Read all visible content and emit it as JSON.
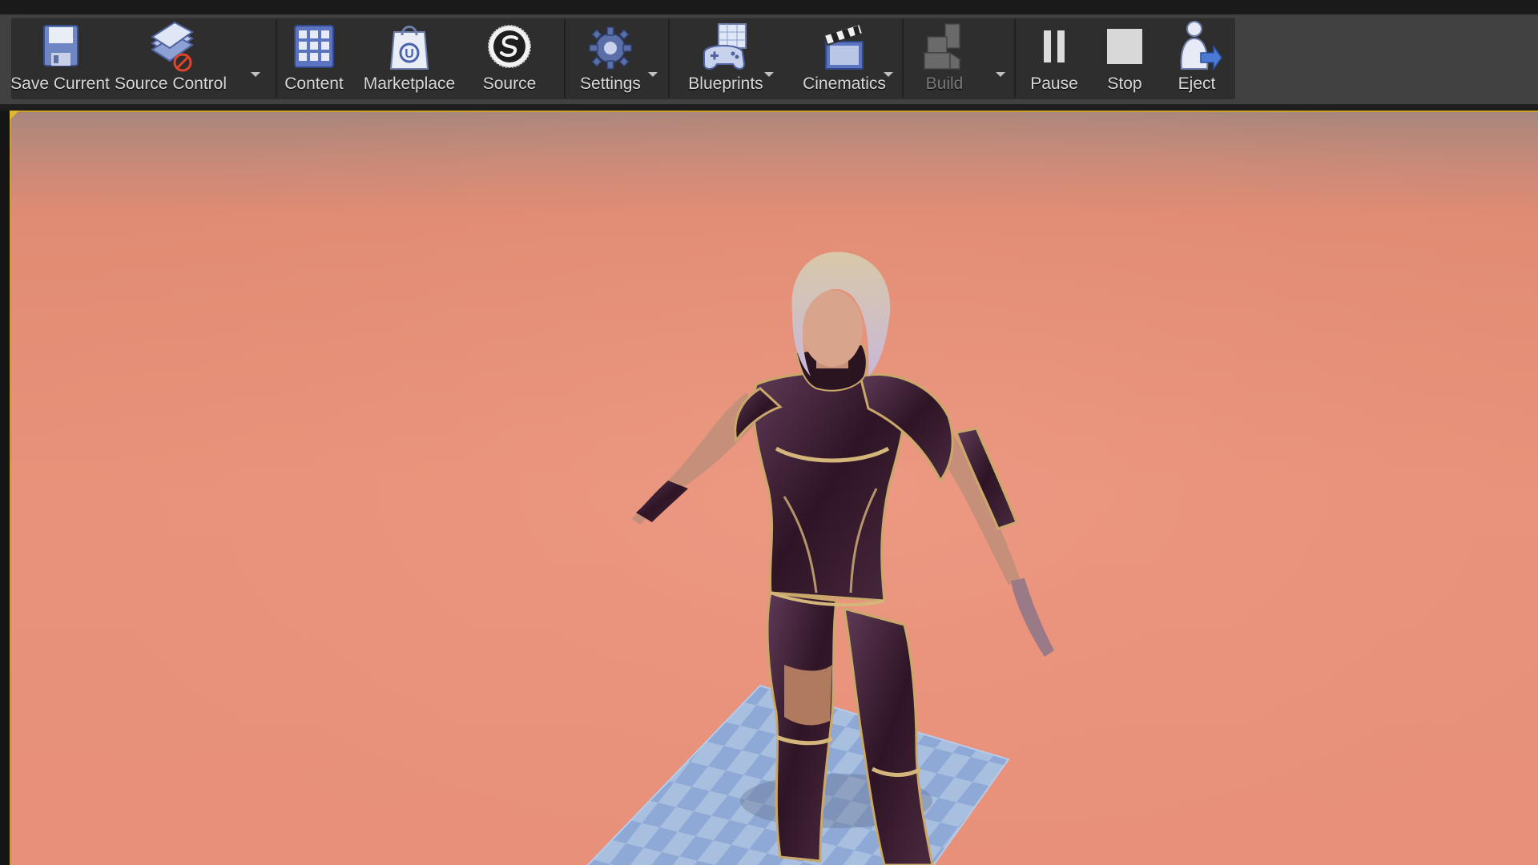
{
  "toolbar": {
    "buttons": [
      {
        "id": "save_current",
        "label": "Save Current",
        "icon": "floppy-disk-icon",
        "has_dropdown": false,
        "enabled": true
      },
      {
        "id": "source_control",
        "label": "Source Control",
        "icon": "source-control-icon",
        "has_dropdown": true,
        "enabled": true
      },
      {
        "id": "content",
        "label": "Content",
        "icon": "content-grid-icon",
        "has_dropdown": false,
        "enabled": true
      },
      {
        "id": "marketplace",
        "label": "Marketplace",
        "icon": "marketplace-bag-icon",
        "has_dropdown": false,
        "enabled": true
      },
      {
        "id": "source",
        "label": "Source",
        "icon": "source-logo-icon",
        "has_dropdown": false,
        "enabled": true
      },
      {
        "id": "settings",
        "label": "Settings",
        "icon": "gear-icon",
        "has_dropdown": true,
        "enabled": true
      },
      {
        "id": "blueprints",
        "label": "Blueprints",
        "icon": "gamepad-icon",
        "has_dropdown": true,
        "enabled": true
      },
      {
        "id": "cinematics",
        "label": "Cinematics",
        "icon": "clapperboard-icon",
        "has_dropdown": true,
        "enabled": true
      },
      {
        "id": "build",
        "label": "Build",
        "icon": "build-blocks-icon",
        "has_dropdown": true,
        "enabled": false
      },
      {
        "id": "pause",
        "label": "Pause",
        "icon": "pause-icon",
        "has_dropdown": false,
        "enabled": true
      },
      {
        "id": "stop",
        "label": "Stop",
        "icon": "stop-icon",
        "has_dropdown": false,
        "enabled": true
      },
      {
        "id": "eject",
        "label": "Eject",
        "icon": "eject-icon",
        "has_dropdown": false,
        "enabled": true
      }
    ]
  },
  "viewport": {
    "background_color": "#e8907a",
    "ground_color": "#a9bfe0",
    "character_armor_color": "#3a1a2c"
  },
  "colors": {
    "toolbar_bg": "#2e2e2e",
    "accent_gold": "#c9a227",
    "label_text": "#d8d8d8"
  }
}
